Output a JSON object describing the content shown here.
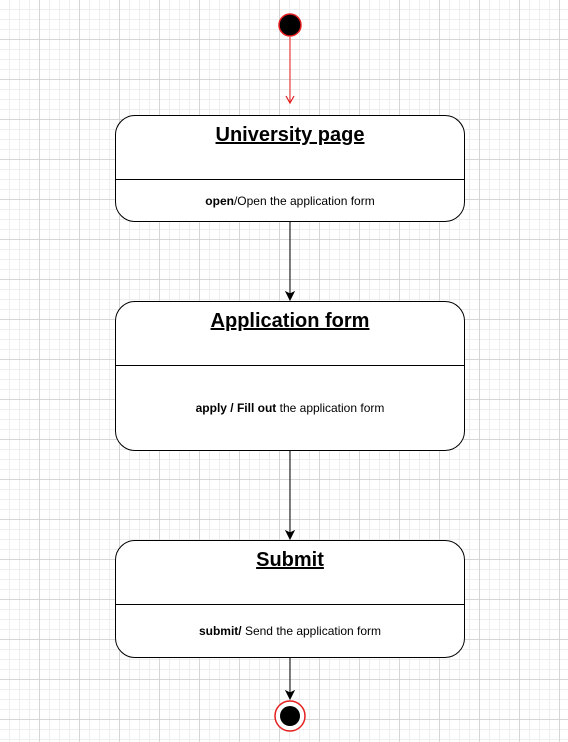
{
  "diagram": {
    "colors": {
      "initial_arrow": "#e51e1e",
      "final_ring": "#e51e1e",
      "stroke": "#000000"
    },
    "states": [
      {
        "name": "University page",
        "action_event": "open",
        "action_text": "/Open the application form"
      },
      {
        "name": "Application form",
        "action_event": "apply / Fill out",
        "action_text": " the application form"
      },
      {
        "name": "Submit",
        "action_event": "submit/",
        "action_text": " Send the application form"
      }
    ]
  }
}
